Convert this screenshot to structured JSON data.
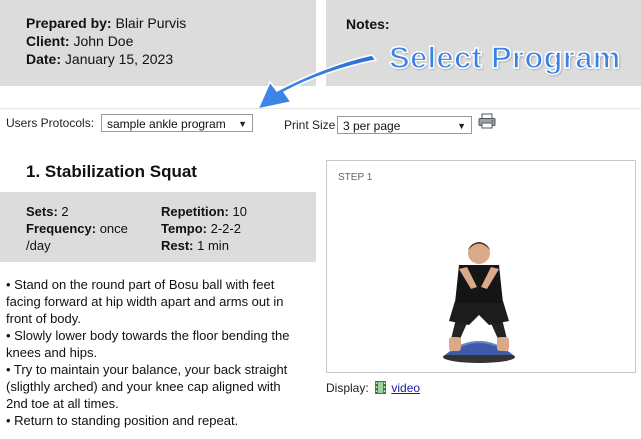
{
  "header": {
    "prepared_by_label": "Prepared by:",
    "prepared_by_value": "Blair Purvis",
    "client_label": "Client:",
    "client_value": "John Doe",
    "date_label": "Date:",
    "date_value": "January 15, 2023",
    "notes_label": "Notes:"
  },
  "annotation": {
    "text": "Select Program",
    "color": "#3b82e6"
  },
  "controls": {
    "protocols_label": "Users Protocols:",
    "protocols_value": "sample ankle program",
    "print_size_label": "Print Size",
    "print_size_value": "3 per page",
    "printer_icon": "printer-icon"
  },
  "exercise": {
    "title": "1. Stabilization Squat",
    "sets_label": "Sets:",
    "sets_value": "2",
    "frequency_label": "Frequency:",
    "frequency_value_1": "once",
    "frequency_value_2": "/day",
    "repetition_label": "Repetition:",
    "repetition_value": "10",
    "tempo_label": "Tempo:",
    "tempo_value": "2-2-2",
    "rest_label": "Rest:",
    "rest_value": "1 min",
    "instructions": [
      "• Stand on the round part of Bosu ball with feet",
      "facing forward at hip width apart and arms out in",
      "front of body.",
      "• Slowly lower body towards the floor bending the",
      "knees and hips.",
      "• Try to maintain your balance, your back straight",
      "(sligthly arched) and your knee cap aligned with",
      "2nd toe at all times.",
      "• Return to standing position and repeat."
    ],
    "step_label": "STEP 1",
    "display_label": "Display:",
    "video_link": "video"
  }
}
